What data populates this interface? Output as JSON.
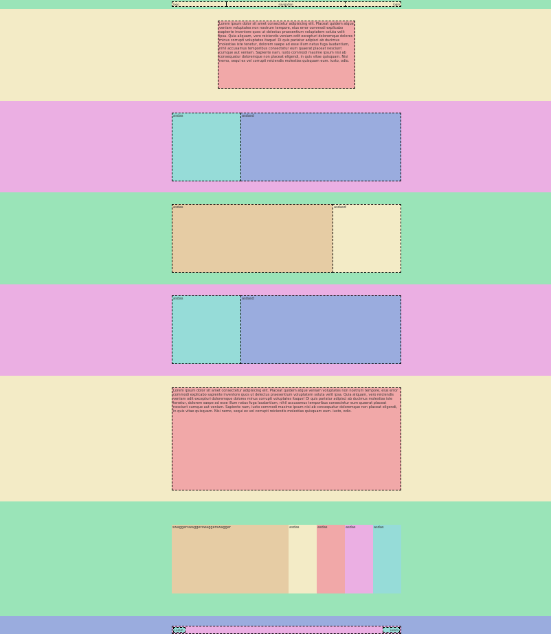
{
  "colors": {
    "green": "#9ae4b8",
    "cream": "#f3ebc6",
    "pink": "#ebafe3",
    "salmon": "#f1a8a8",
    "teal": "#96dcd8",
    "blue": "#9aacde",
    "tan": "#e6cca4"
  },
  "header": {
    "left": "logo",
    "center": "navigation",
    "right": "login"
  },
  "intro": {
    "text": "Lorem ipsum dolor sit amet consectetur adipisicing elit. Placeat quidem atque veniam voluptates non nostrum tempore, eius error commodi explicabo sapiente inventore quos ut delectus praesentium voluptatem soluta velit ipsa. Quia aliquam, vero reiciendis veniam odit excepturi doloremque dolores minus corrupti voluptates itaque! Di quis pariatur adipisci ab ducimus molestias iste tenetur, dolorem saepe ad esse illum natus fuga laudantium, nihil accusamus temporibus consectetur eum quaerat placeat nesciunt cumque aut veniam. Sapiente nam, iusto commodi maxime ipsum nisi ab consequatur doloremque non placeat eligendi, in quis vitae quisquam. Nisi nemo, sequi ex vel corrupti reiciendis molestias quisquam eum. iusto, odio."
  },
  "row1": {
    "left": "asdas",
    "right": "asdasd"
  },
  "row2": {
    "left": "asdas",
    "right": "asdasd"
  },
  "row3": {
    "left": "asdas",
    "right": "asdasd"
  },
  "article": {
    "text": "Lorem ipsum dolor sit amet consectetur adipisicing elit. Placeat quidem atque veniam voluptates non nostrum tempore, eius error commodi explicabo sapiente inventore quos ut delectus praesentium voluptatem soluta velit ipsa. Quia aliquam, vero reiciendis veniam odit excepturi doloremque dolores minus corrupti voluptates itaque! Di quis pariatur adipisci ab ducimus molestias iste tenetur, dolorem saepe ad esse illum natus fuga laudantium, nihil accusamus temporibus consectetur eum quaerat placeat nesciunt cumque aut veniam. Sapiente nam, iusto commodi maxime ipsum nisi ab consequatur doloremque non placeat eligendi, in quis vitae quisquam. Nisi nemo, sequi ex vel corrupti reiciendis molestias quisquam eum. iusto, odio."
  },
  "gallery": {
    "first": "swaggerswaggerswaggerswagger",
    "items": [
      "asdas",
      "asdas",
      "asdas",
      "asdas"
    ]
  },
  "footer": {
    "left": "Lorem",
    "right": "Lorem"
  }
}
